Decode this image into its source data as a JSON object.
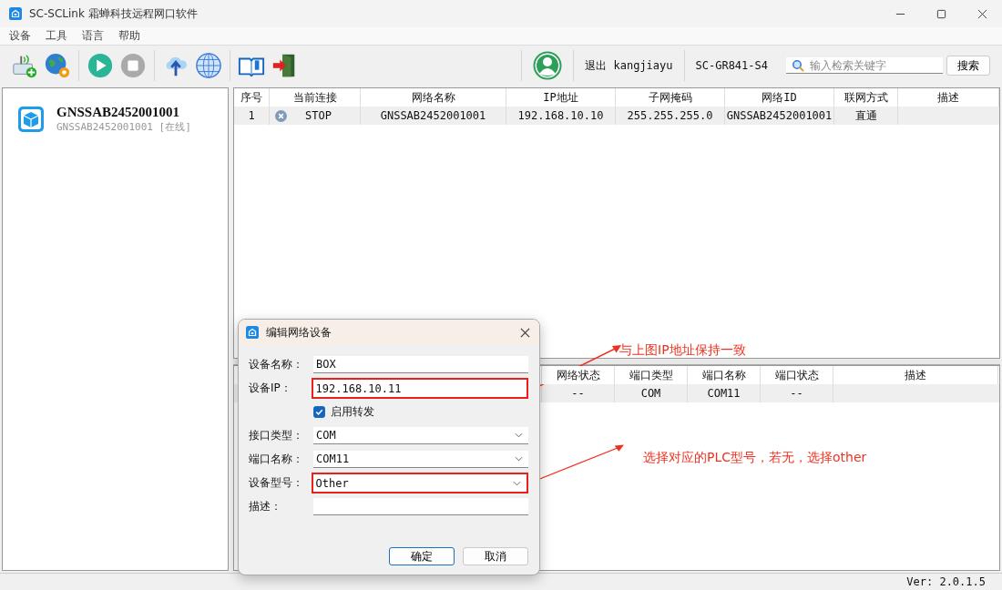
{
  "window": {
    "title": "SC-SCLink 霜蝉科技远程网口软件"
  },
  "menu": [
    "设备",
    "工具",
    "语言",
    "帮助"
  ],
  "toolbar": {
    "user": "退出 kangjiayu",
    "device_model": "SC-GR841-S4",
    "search": {
      "placeholder": "输入检索关键字"
    },
    "search_button": "搜索"
  },
  "sidebar": {
    "items": [
      {
        "name": "GNSSAB2452001001",
        "subtitle": "GNSSAB2452001001 [在线]"
      }
    ]
  },
  "network_table": {
    "columns": [
      "序号",
      "当前连接",
      "网络名称",
      "IP地址",
      "子网掩码",
      "网络ID",
      "联网方式",
      "描述"
    ],
    "rows": [
      {
        "connected": false,
        "cells": [
          "1",
          "STOP",
          "GNSSAB2452001001",
          "192.168.10.10",
          "255.255.255.0",
          "GNSSAB2452001001",
          "直通"
        ]
      }
    ]
  },
  "port_table": {
    "columns": [
      "网络状态",
      "端口类型",
      "端口名称",
      "端口状态",
      "描述"
    ],
    "rows": [
      [
        "--",
        "COM",
        "COM11",
        "--"
      ]
    ]
  },
  "dialog": {
    "title": "编辑网络设备",
    "fields": [
      {
        "kind": "text",
        "label": "设备名称：",
        "value": "BOX",
        "highlighted": false
      },
      {
        "kind": "text",
        "label": "设备IP：",
        "value": "192.168.10.11",
        "highlighted": true
      },
      {
        "kind": "checkbox",
        "label": "启用转发",
        "checked": true
      },
      {
        "kind": "select",
        "label": "接口类型：",
        "value": "COM",
        "highlighted": false
      },
      {
        "kind": "select",
        "label": "端口名称：",
        "value": "COM11",
        "highlighted": false
      },
      {
        "kind": "select",
        "label": "设备型号：",
        "value": "Other",
        "highlighted": true
      },
      {
        "kind": "text",
        "label": "描述：",
        "highlighted": false
      }
    ],
    "buttons": [
      {
        "label": "确定",
        "default": true
      },
      {
        "label": "取消",
        "default": false
      }
    ]
  },
  "annotations": [
    {
      "text": "与上图IP地址保持一致"
    },
    {
      "text": "选择对应的PLC型号，若无，选择other"
    }
  ],
  "status_bar": {
    "version": "Ver: 2.0.1.5"
  }
}
